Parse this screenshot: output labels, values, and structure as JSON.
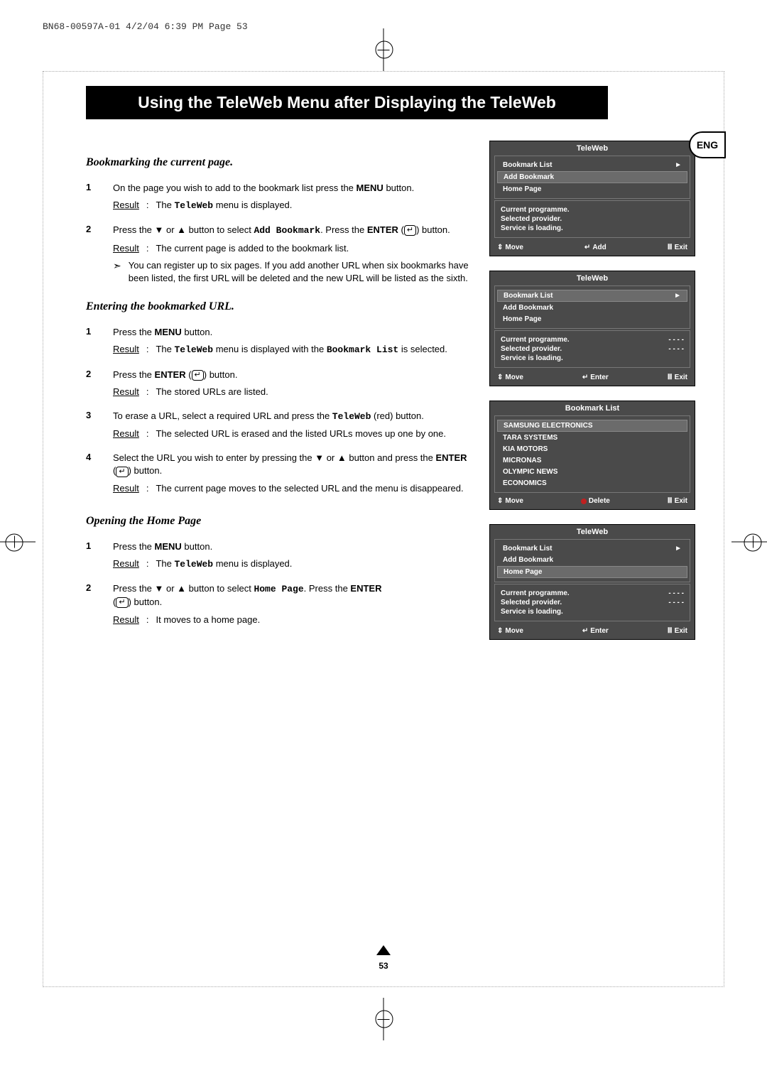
{
  "meta": {
    "header": "BN68-00597A-01  4/2/04  6:39 PM  Page 53"
  },
  "title": "Using the TeleWeb Menu after Displaying the TeleWeb",
  "lang": "ENG",
  "page_number": "53",
  "labels": {
    "result": "Result",
    "menu": "MENU",
    "enter": "ENTER",
    "teleweb": "TeleWeb",
    "add_bookmark": "Add Bookmark",
    "bookmark_list": "Bookmark List",
    "home_page": "Home Page"
  },
  "sections": {
    "bookmarking": {
      "heading": "Bookmarking the current page.",
      "step1": {
        "num": "1",
        "line_a": "On the page you wish to add to the bookmark list press the",
        "line_b": " button.",
        "result": "menu is displayed."
      },
      "step2": {
        "num": "2",
        "line_a": "Press the ▼ or ▲ button to select ",
        "line_b": ". Press the",
        "line_c": " (",
        "line_d": ") button.",
        "result": "The current page is added to the bookmark list.",
        "note": "You can register up to six pages. If you add another URL when six bookmarks have been listed, the first URL will be deleted and the new URL will be listed as the sixth."
      }
    },
    "entering": {
      "heading": "Entering the bookmarked URL.",
      "step1": {
        "num": "1",
        "line": "Press the ",
        "line_b": " button.",
        "result_a": "The ",
        "result_b": " menu is displayed with the ",
        "result_c": " is selected."
      },
      "step2": {
        "num": "2",
        "line_a": "Press the ",
        "line_b": " (",
        "line_c": ") button.",
        "result": "The stored URLs are listed."
      },
      "step3": {
        "num": "3",
        "line_a": "To erase a URL, select a required URL and press the ",
        "line_b": " (red) button.",
        "result": "The  selected URL is erased and the listed URLs moves up one by one."
      },
      "step4": {
        "num": "4",
        "line_a": "Select the URL you wish to enter by pressing the ▼ or ▲ button and press the ",
        "line_b": " (",
        "line_c": ") button.",
        "result": "The current page moves to the selected URL and the menu is disappeared."
      }
    },
    "opening": {
      "heading": "Opening the Home Page",
      "step1": {
        "num": "1",
        "line_a": "Press the ",
        "line_b": " button.",
        "result_a": "The ",
        "result_b": " menu is displayed."
      },
      "step2": {
        "num": "2",
        "line_a": "Press the ▼ or ▲ button to select ",
        "line_b": ". Press the ",
        "line_c": " (",
        "line_d": ") button.",
        "result": "It moves to a home page."
      }
    }
  },
  "osd": {
    "teleweb_title": "TeleWeb",
    "bookmark_list_title": "Bookmark List",
    "menu_items": {
      "bookmark_list": "Bookmark List",
      "add_bookmark": "Add Bookmark",
      "home_page": "Home Page"
    },
    "info": {
      "current_programme": "Current programme.",
      "selected_provider": "Selected provider.",
      "service_loading": "Service is loading.",
      "dashes": "- - - -"
    },
    "footer": {
      "move": "Move",
      "add": "Add",
      "enter": "Enter",
      "delete": "Delete",
      "exit": "Exit"
    },
    "bookmarks": [
      "SAMSUNG ELECTRONICS",
      "TARA SYSTEMS",
      "KIA MOTORS",
      "MICRONAS",
      "OLYMPIC NEWS",
      "ECONOMICS"
    ]
  }
}
